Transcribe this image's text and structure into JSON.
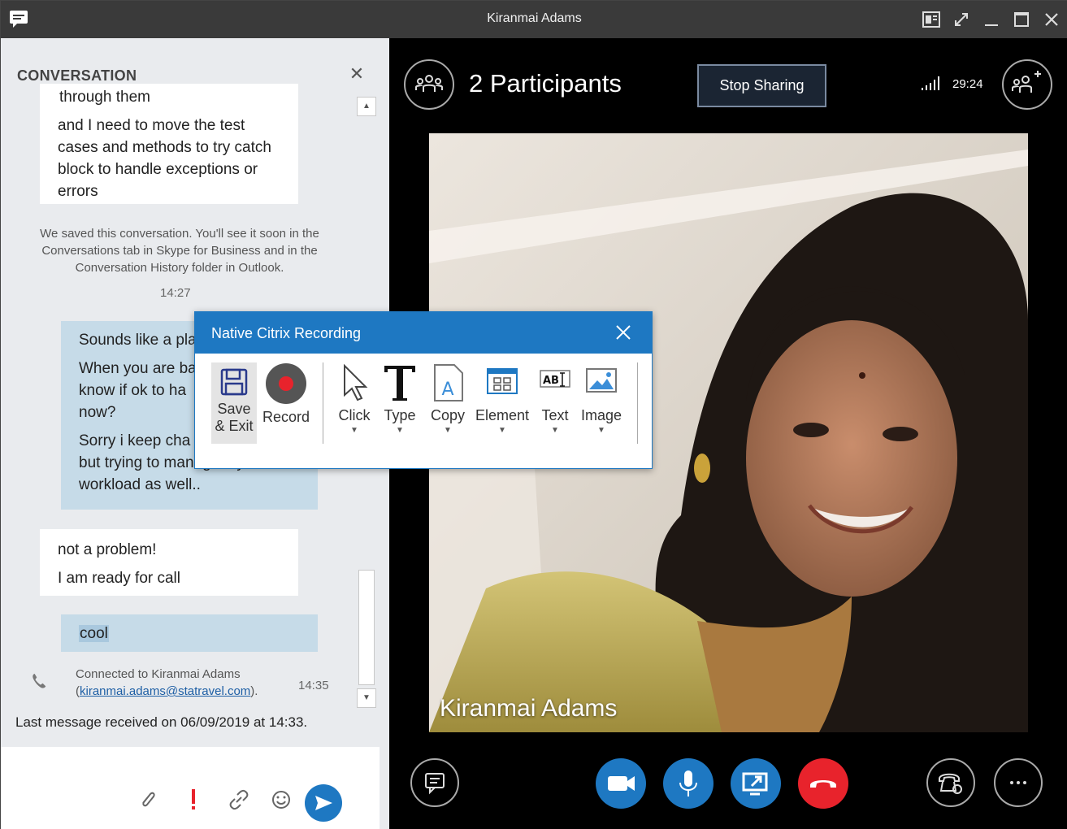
{
  "window": {
    "title": "Kiranmai Adams",
    "controls": [
      "share-icon",
      "popout-icon",
      "minimize-icon",
      "maximize-icon",
      "close-icon"
    ]
  },
  "conversation": {
    "header": "CONVERSATION",
    "cutoff_text": "through them",
    "messages": [
      {
        "type": "in",
        "text": "and I need to move the test cases and methods to try catch block to handle exceptions or errors"
      },
      {
        "type": "system",
        "text": "We saved this conversation. You'll see it soon in the Conversations tab in Skype for Business and in the Conversation History folder in Outlook."
      },
      {
        "type": "timestamp",
        "text": "14:27"
      },
      {
        "type": "out",
        "lines": [
          "Sounds like a pla",
          "When you are ba",
          "know if ok to ha",
          "now?",
          "Sorry i keep cha",
          "but trying to manage my",
          "workload as well.."
        ]
      },
      {
        "type": "in",
        "lines": [
          "not a problem!",
          "I am ready for call"
        ]
      },
      {
        "type": "out",
        "text": "cool"
      }
    ],
    "connected_text": "Connected to Kiranmai Adams",
    "connected_email": "kiranmai.adams@statravel.com",
    "connected_time": "14:35",
    "last_message": "Last message received on 06/09/2019 at 14:33."
  },
  "compose": {
    "icons": [
      "attach-icon",
      "priority-icon",
      "link-icon",
      "emoji-icon",
      "send-icon"
    ]
  },
  "video": {
    "participants": "2 Participants",
    "stop_sharing": "Stop Sharing",
    "timer": "29:24",
    "caller_name": "Kiranmai Adams"
  },
  "citrix": {
    "title": "Native Citrix Recording",
    "tools": [
      {
        "label1": "Save",
        "label2": "& Exit"
      },
      {
        "label1": "Record"
      },
      {
        "label1": "Click"
      },
      {
        "label1": "Type"
      },
      {
        "label1": "Copy"
      },
      {
        "label1": "Element"
      },
      {
        "label1": "Text"
      },
      {
        "label1": "Image"
      }
    ]
  },
  "colors": {
    "accent": "#1e78c2",
    "hangup": "#e8232c",
    "bubble_out": "#c6dbe8"
  }
}
